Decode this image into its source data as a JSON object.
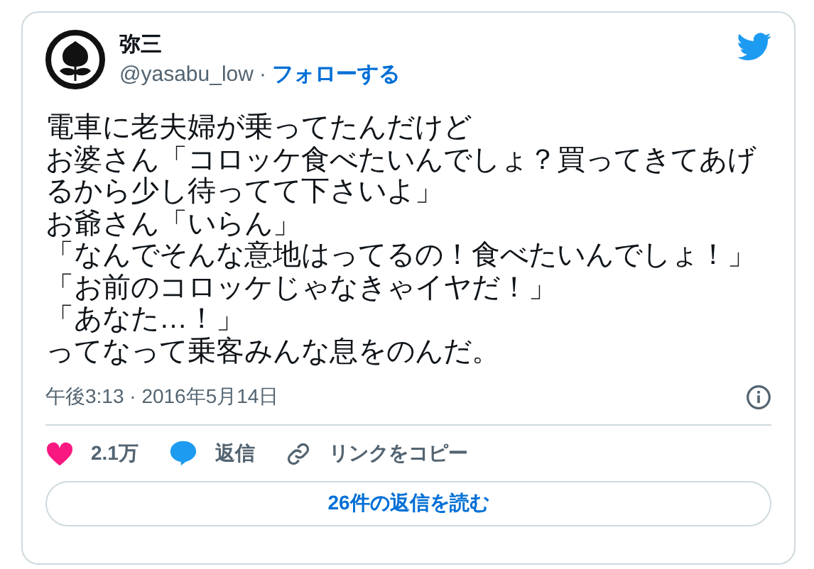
{
  "author": {
    "name": "弥三",
    "handle": "@yasabu_low",
    "separator": "·",
    "follow": "フォローする"
  },
  "text_lines": [
    "電車に老夫婦が乗ってたんだけど",
    "お婆さん「コロッケ食べたいんでしょ？買ってきてあげるから少し待ってて下さいよ」",
    "お爺さん「いらん」",
    "「なんでそんな意地はってるの！食べたいんでしょ！」",
    "「お前のコロッケじゃなきゃイヤだ！」",
    "「あなた…！」",
    "ってなって乗客みんな息をのんだ。"
  ],
  "timestamp": "午後3:13 · 2016年5月14日",
  "actions": [
    {
      "kind": "like",
      "label": "2.1万"
    },
    {
      "kind": "reply",
      "label": "返信"
    },
    {
      "kind": "link",
      "label": "リンクをコピー"
    }
  ],
  "read_replies": "26件の返信を読む"
}
